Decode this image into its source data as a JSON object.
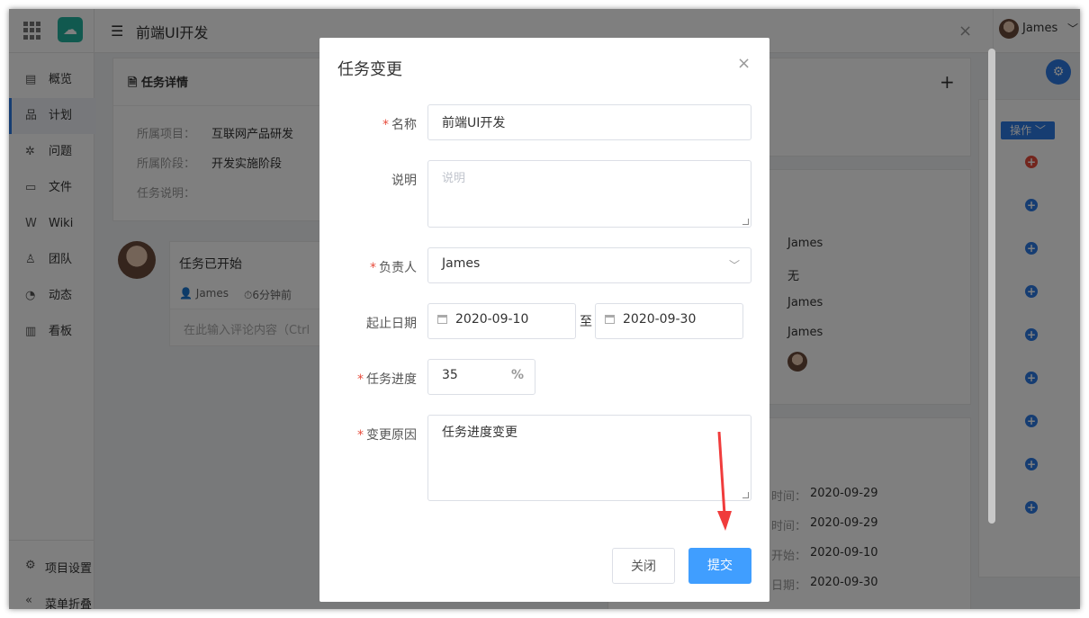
{
  "app": {
    "title": "前端UI开发",
    "user_name": "James"
  },
  "nav": {
    "items": [
      {
        "label": "概览",
        "icon": "overview-icon",
        "glyph": "▤"
      },
      {
        "label": "计划",
        "icon": "plan-icon",
        "glyph": "品"
      },
      {
        "label": "问题",
        "icon": "bug-icon",
        "glyph": "✲"
      },
      {
        "label": "文件",
        "icon": "folder-icon",
        "glyph": "▭"
      },
      {
        "label": "Wiki",
        "icon": "wiki-icon",
        "glyph": "W"
      },
      {
        "label": "团队",
        "icon": "team-icon",
        "glyph": "♙"
      },
      {
        "label": "动态",
        "icon": "activity-icon",
        "glyph": "◔"
      },
      {
        "label": "看板",
        "icon": "board-icon",
        "glyph": "▥"
      }
    ],
    "active_index": 1,
    "project_settings": "项目设置",
    "collapse_menu": "菜单折叠"
  },
  "task_card": {
    "title": "任务详情",
    "project_label": "所属项目：",
    "project_value": "互联网产品研发",
    "stage_label": "所属阶段：",
    "stage_value": "开发实施阶段",
    "desc_label": "任务说明："
  },
  "activity": {
    "status": "任务已开始",
    "author": "James",
    "time": "6分钟前",
    "comment_placeholder": "在此输入评论内容（Ctrl"
  },
  "right_panel": {
    "side_values": [
      "James",
      "无",
      "James",
      "James"
    ],
    "op_label": "操作",
    "dates_partial": [
      {
        "label": "时间：",
        "value": "2020-09-29"
      },
      {
        "label": "时间：",
        "value": "2020-09-29"
      },
      {
        "label": "开始：",
        "value": "2020-09-10"
      },
      {
        "label": "日期：",
        "value": "2020-09-30"
      }
    ]
  },
  "modal": {
    "title": "任务变更",
    "name_label": "名称",
    "name_value": "前端UI开发",
    "desc_label": "说明",
    "desc_placeholder": "说明",
    "owner_label": "负责人",
    "owner_value": "James",
    "date_label": "起止日期",
    "start_date": "2020-09-10",
    "date_sep": "至",
    "end_date": "2020-09-30",
    "progress_label": "任务进度",
    "progress_value": "35",
    "progress_unit": "%",
    "reason_label": "变更原因",
    "reason_value": "任务进度变更",
    "close_btn": "关闭",
    "submit_btn": "提交"
  },
  "colors": {
    "accent": "#409eff",
    "required": "#e74c3c",
    "arrow": "#f03c3c"
  }
}
